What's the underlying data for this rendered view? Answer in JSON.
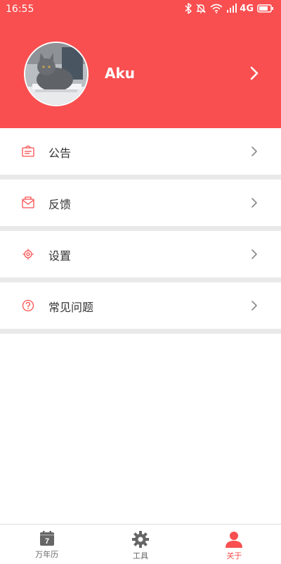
{
  "status_bar": {
    "time": "16:55",
    "network": "4G",
    "icons": [
      "bluetooth-icon",
      "mute-bell-icon",
      "wifi-icon",
      "signal-icon",
      "battery-icon"
    ]
  },
  "profile": {
    "username": "Aku",
    "avatar": "cat-photo-avatar"
  },
  "menu": [
    {
      "label": "公告",
      "icon": "announcement-icon"
    },
    {
      "label": "反馈",
      "icon": "feedback-mail-icon"
    },
    {
      "label": "设置",
      "icon": "settings-gear-icon"
    },
    {
      "label": "常见问题",
      "icon": "question-icon"
    }
  ],
  "tabbar": {
    "tabs": [
      {
        "label": "万年历",
        "icon": "calendar-icon",
        "icon_text": "7"
      },
      {
        "label": "工具",
        "icon": "gear-icon"
      },
      {
        "label": "关于",
        "icon": "user-icon"
      }
    ],
    "active_index": 2
  },
  "colors": {
    "accent": "#f94f50",
    "divider": "#e9e9e9",
    "text": "#333333",
    "inactive_tab_icon": "#666666"
  }
}
